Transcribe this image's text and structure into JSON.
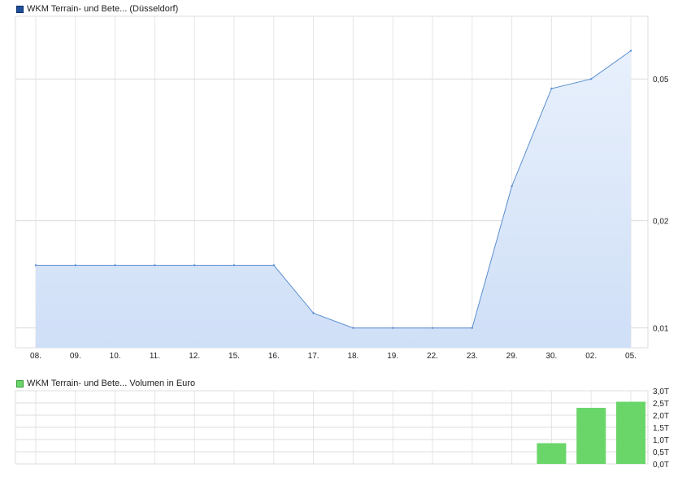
{
  "chart_data": [
    {
      "type": "area",
      "legend": "WKM Terrain- und Bete... (Düsseldorf)",
      "legend_color": "#1f4f9c",
      "x": [
        "08.",
        "09.",
        "10.",
        "11.",
        "12.",
        "15.",
        "16.",
        "17.",
        "18.",
        "19.",
        "22.",
        "23.",
        "29.",
        "30.",
        "02.",
        "05."
      ],
      "values": [
        0.015,
        0.015,
        0.015,
        0.015,
        0.015,
        0.015,
        0.015,
        0.011,
        0.01,
        0.01,
        0.01,
        0.01,
        0.025,
        0.047,
        0.05,
        0.06
      ],
      "yticks": [
        {
          "value": 0.05,
          "label": "0,05"
        },
        {
          "value": 0.02,
          "label": "0,02"
        },
        {
          "value": 0.01,
          "label": "0,01"
        }
      ],
      "ylim": [
        0.0088,
        0.075
      ],
      "y_scale": "log",
      "grid": true,
      "line_color": "#5b8fd1",
      "fill_top": "#e8f0fc",
      "fill_bottom": "#cfdff7"
    },
    {
      "type": "bar",
      "legend": "WKM Terrain- und Bete... Volumen in Euro",
      "legend_color": "#6ad66a",
      "categories": [
        "08.",
        "09.",
        "10.",
        "11.",
        "12.",
        "15.",
        "16.",
        "17.",
        "18.",
        "19.",
        "22.",
        "23.",
        "29.",
        "30.",
        "02.",
        "05."
      ],
      "values": [
        0,
        0,
        0,
        0,
        0,
        0,
        0,
        0,
        0,
        0,
        0,
        0,
        0,
        0.85,
        2.3,
        2.55
      ],
      "yticks": [
        {
          "value": 0,
          "label": "0,0T"
        },
        {
          "value": 0.5,
          "label": "0,5T"
        },
        {
          "value": 1.0,
          "label": "1,0T"
        },
        {
          "value": 1.5,
          "label": "1,5T"
        },
        {
          "value": 2.0,
          "label": "2,0T"
        },
        {
          "value": 2.5,
          "label": "2,5T"
        },
        {
          "value": 3.0,
          "label": "3,0T"
        }
      ],
      "ylim": [
        0,
        3.0
      ],
      "grid": true,
      "bar_color": "#6ad66a"
    }
  ]
}
